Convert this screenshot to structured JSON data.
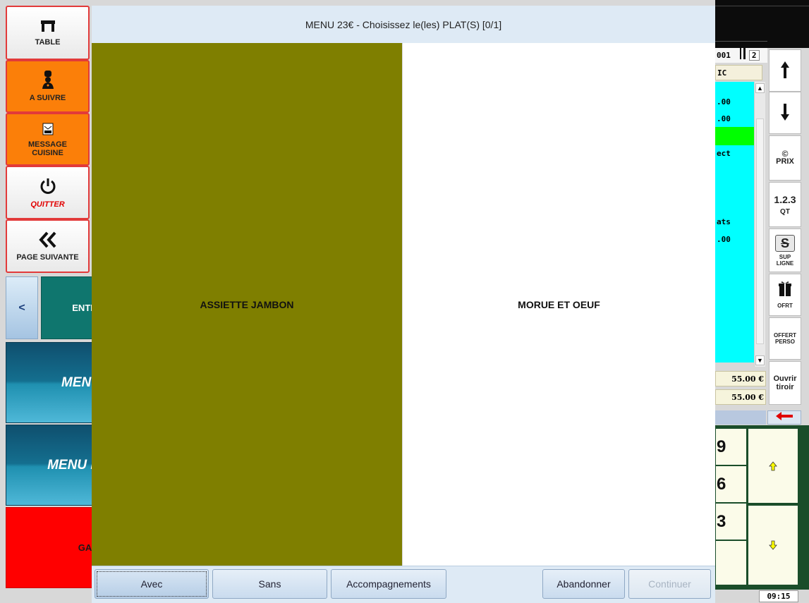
{
  "left_buttons": {
    "table": "TABLE",
    "a_suivre": "A SUIVRE",
    "message_cuisine_1": "MESSAGE",
    "message_cuisine_2": "CUISINE",
    "quitter": "QUITTER",
    "page_suivante": "PAGE SUIVANTE"
  },
  "categories": {
    "prev": "<",
    "tab": "ENTREE",
    "tiles": [
      "MENU",
      "MENU E",
      "GARN"
    ]
  },
  "dialog": {
    "title": "MENU 23€ - Choisissez le(les) PLAT(S) [0/1]",
    "options": [
      {
        "label": "ASSIETTE JAMBON",
        "color": "#7f7f00"
      },
      {
        "label": "MORUE ET OEUF",
        "color": "#ffffff"
      }
    ],
    "buttons": {
      "avec": "Avec",
      "sans": "Sans",
      "accompagnements": "Accompagnements",
      "abandonner": "Abandonner",
      "continuer": "Continuer"
    }
  },
  "order_panel": {
    "table_no": "001",
    "covers": "2",
    "header_text": "IC",
    "lines": [
      ".00",
      ".00",
      "ect",
      "ats",
      ".00"
    ],
    "total_1": "55.00 €",
    "total_2": "55.00 €",
    "clock": "09:15"
  },
  "right_tools": {
    "prix": "PRIX",
    "qt_digits": "1.2.3",
    "qt": "QT",
    "sup_1": "SUP",
    "sup_2": "LIGNE",
    "offert": "OFRT",
    "offert_perso_1": "OFFERT",
    "offert_perso_2": "PERSO",
    "ouvrir_1": "Ouvrir",
    "ouvrir_2": "tiroir"
  },
  "keypad": [
    "9",
    "6",
    "3"
  ],
  "colors": {
    "accent_orange": "#fb7f09",
    "list_cyan": "#00ffff",
    "highlight_green": "#00ff00",
    "garniture_red": "#ff0000"
  }
}
